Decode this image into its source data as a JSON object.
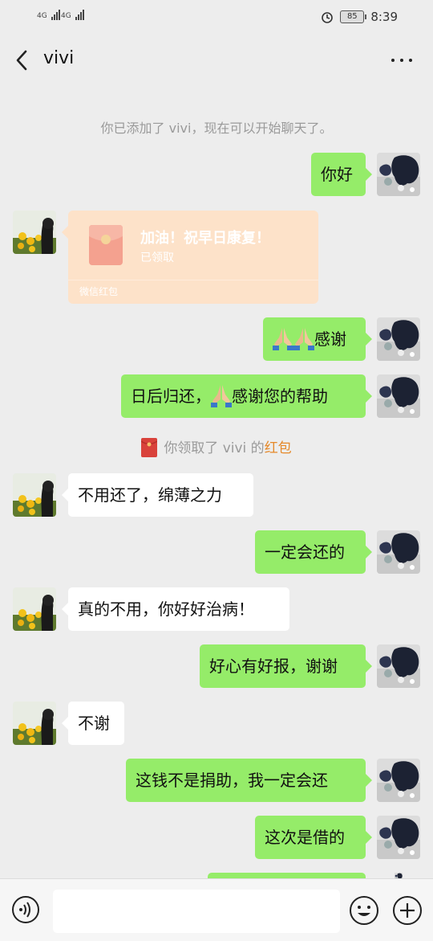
{
  "status_bar": {
    "net1": "4G",
    "net2": "4G",
    "battery": "85",
    "time": "8:39"
  },
  "header": {
    "title": "vivi"
  },
  "messages": {
    "system_added": "你已添加了 vivi，现在可以开始聊天了。",
    "m1": "你好",
    "redpacket": {
      "title": "加油！祝早日康复！",
      "status": "已领取",
      "footer": "微信红包"
    },
    "m2": "感谢",
    "m3_prefix": "日后归还，",
    "m3_suffix": "感谢您的帮助",
    "notice_prefix": "你领取了 vivi 的",
    "notice_link": "红包",
    "m4": "不用还了，绵薄之力",
    "m5": "一定会还的",
    "m6": "真的不用，你好好治病！",
    "m7": "好心有好报，谢谢",
    "m8": "不谢",
    "m9": "这钱不是捐助，我一定会还",
    "m10": "这次是借的"
  },
  "icons": {
    "back": "chevron-left-icon",
    "more": "more-dots-icon",
    "voice": "voice-icon",
    "emoji": "emoji-icon",
    "plus": "plus-icon"
  },
  "colors": {
    "outgoing_bubble": "#95ec69",
    "incoming_bubble": "#ffffff",
    "background": "#ededed",
    "redpacket": "#fde2c9",
    "link": "#e5892a"
  }
}
